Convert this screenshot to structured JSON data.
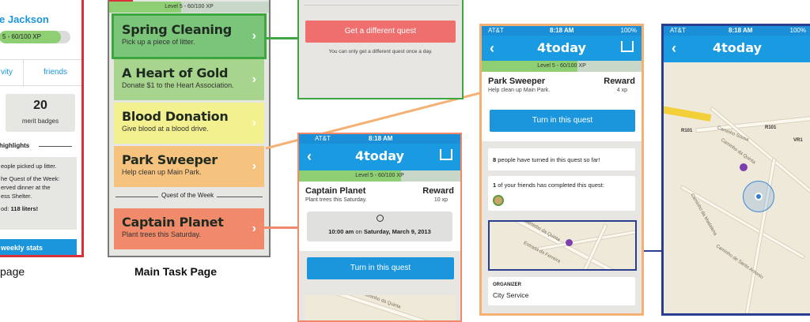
{
  "profile": {
    "name": "e Jackson",
    "xp": "5 - 60/100 XP",
    "tab_activity": "vity",
    "tab_friends": "friends",
    "merit_count": "20",
    "merit_label": "merit badges",
    "highlights_label": "highlights",
    "highlight_lines": [
      "eople picked up litter.",
      "he Quest of the Week:",
      "erved dinner at the",
      "ess Shelter.",
      "od: "
    ],
    "highlight_value": "118 liters!",
    "weekly_button": "weekly stats",
    "caption": "page"
  },
  "main": {
    "level": "Level 5 - 60/100 XP",
    "quests": [
      {
        "title": "Spring Cleaning",
        "subtitle": "Pick up a piece of litter.",
        "color": "#7bc57b"
      },
      {
        "title": "A Heart of Gold",
        "subtitle": "Donate $1 to the Heart Association.",
        "color": "#a8d58d"
      },
      {
        "title": "Blood Donation",
        "subtitle": "Give blood at a blood drive.",
        "color": "#f2f08f"
      },
      {
        "title": "Park Sweeper",
        "subtitle": "Help clean up Main Park.",
        "color": "#f6c37f"
      }
    ],
    "quest_of_week_label": "Quest of the Week",
    "week_quest": {
      "title": "Captain Planet",
      "subtitle": "Plant trees this Saturday.",
      "color": "#f08a6b"
    },
    "caption": "Main Task Page"
  },
  "quest_panel": {
    "different_button": "Get a different quest",
    "note": "You can only get a different quest once a day."
  },
  "captain_screen": {
    "carrier": "AT&T",
    "time": "8:18 AM",
    "app_title": "4today",
    "level": "Level 5 - 60/100 XP",
    "quest_title": "Captain Planet",
    "quest_sub": "Plant trees this Saturday.",
    "reward_label": "Reward",
    "reward_value": "10 xp",
    "event_time": "10:00 am",
    "event_on": "on",
    "event_date": "Saturday, March 9, 2013",
    "turn_in": "Turn in this quest"
  },
  "park_screen": {
    "carrier": "AT&T",
    "time": "8:18 AM",
    "battery": "100%",
    "app_title": "4today",
    "level": "Level 5 - 60/100 XP",
    "quest_title": "Park Sweeper",
    "quest_sub": "Help clean up Main Park.",
    "reward_label": "Reward",
    "reward_value": "4 xp",
    "turn_in": "Turn in this quest",
    "people_count": "8",
    "people_text": "people have turned in this quest so far!",
    "friends_count": "1",
    "friends_text": "of your friends has completed this quest:",
    "organizer_label": "ORGANIZER",
    "organizer_value": "City Service"
  },
  "map_screen": {
    "carrier": "AT&T",
    "time": "8:18 AM",
    "battery": "100%",
    "app_title": "4today",
    "road_r101": "R101",
    "road_r101b": "R101",
    "road_vr1": "VR1",
    "street1": "Caminho da Quinta",
    "street2": "Estrada da Ferreira",
    "street3": "Caminho de Santo Antonio",
    "street4": "Caminho da Madalena",
    "street5": "Caminho Sousa"
  },
  "colors": {
    "accent_blue": "#1b96dd",
    "green_border": "#3ea640",
    "red_border": "#d8313a",
    "orange_border": "#f3b274",
    "navy_border": "#2a3d8f"
  }
}
